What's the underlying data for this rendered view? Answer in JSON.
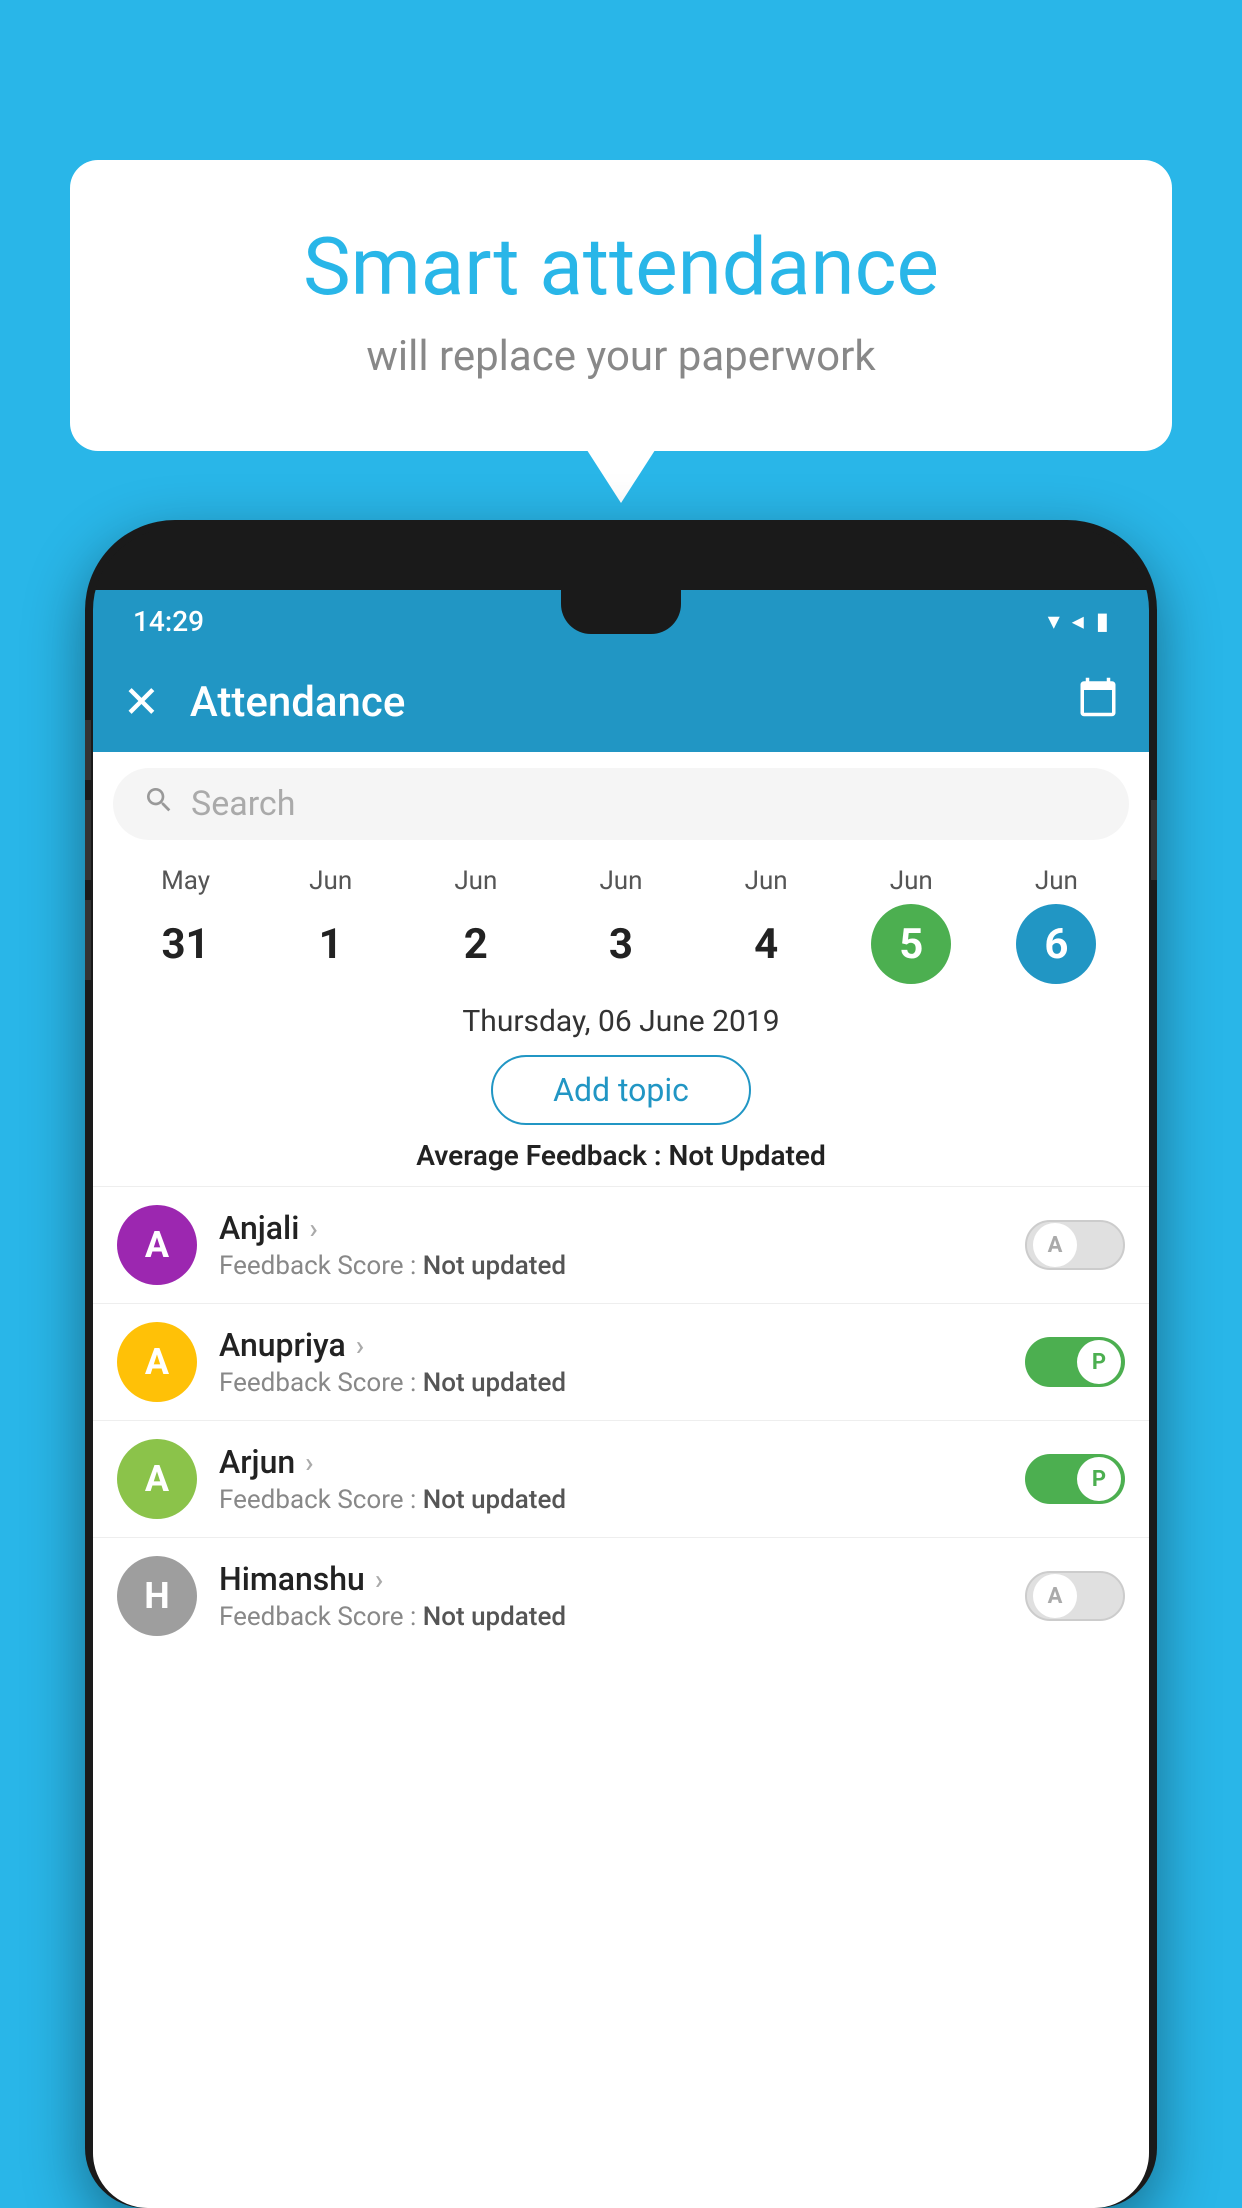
{
  "background_color": "#29b6e8",
  "speech_bubble": {
    "title": "Smart attendance",
    "subtitle": "will replace your paperwork"
  },
  "status_bar": {
    "time": "14:29",
    "wifi": "▾",
    "signal": "▲",
    "battery": "▮"
  },
  "app_bar": {
    "title": "Attendance",
    "close_label": "✕",
    "calendar_label": "📅"
  },
  "search": {
    "placeholder": "Search"
  },
  "calendar": {
    "days": [
      {
        "month": "May",
        "date": "31",
        "style": "normal"
      },
      {
        "month": "Jun",
        "date": "1",
        "style": "normal"
      },
      {
        "month": "Jun",
        "date": "2",
        "style": "normal"
      },
      {
        "month": "Jun",
        "date": "3",
        "style": "normal"
      },
      {
        "month": "Jun",
        "date": "4",
        "style": "normal"
      },
      {
        "month": "Jun",
        "date": "5",
        "style": "green"
      },
      {
        "month": "Jun",
        "date": "6",
        "style": "blue"
      }
    ]
  },
  "selected_date": "Thursday, 06 June 2019",
  "add_topic_label": "Add topic",
  "avg_feedback_label": "Average Feedback : ",
  "avg_feedback_value": "Not Updated",
  "students": [
    {
      "name": "Anjali",
      "avatar_letter": "A",
      "avatar_color": "#9c27b0",
      "feedback_label": "Feedback Score : ",
      "feedback_value": "Not updated",
      "toggle": "off",
      "toggle_letter": "A"
    },
    {
      "name": "Anupriya",
      "avatar_letter": "A",
      "avatar_color": "#ffc107",
      "feedback_label": "Feedback Score : ",
      "feedback_value": "Not updated",
      "toggle": "on",
      "toggle_letter": "P"
    },
    {
      "name": "Arjun",
      "avatar_letter": "A",
      "avatar_color": "#8bc34a",
      "feedback_label": "Feedback Score : ",
      "feedback_value": "Not updated",
      "toggle": "on",
      "toggle_letter": "P"
    },
    {
      "name": "Himanshu",
      "avatar_letter": "H",
      "avatar_color": "#9e9e9e",
      "feedback_label": "Feedback Score : ",
      "feedback_value": "Not updated",
      "toggle": "off",
      "toggle_letter": "A"
    }
  ]
}
